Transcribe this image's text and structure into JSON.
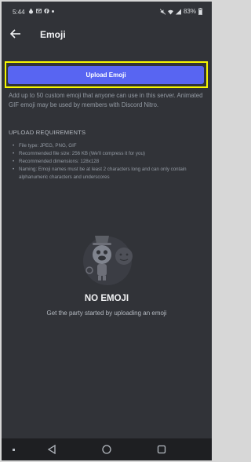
{
  "statusbar": {
    "time": "5:44",
    "battery": "83%"
  },
  "header": {
    "title": "Emoji"
  },
  "upload": {
    "button_label": "Upload Emoji"
  },
  "description": "Add up to 50 custom emoji that anyone can use in this server. Animated GIF emoji may be used by members with Discord Nitro.",
  "requirements": {
    "heading": "UPLOAD REQUIREMENTS",
    "items": [
      "File type: JPEG, PNG, GIF",
      "Recommended file size: 256 KB (We'll compress it for you)",
      "Recommended dimensions: 128x128",
      "Naming: Emoji names must be at least 2 characters long and can only contain alphanumeric characters and underscores"
    ]
  },
  "empty_state": {
    "title": "NO EMOJI",
    "subtitle": "Get the party started by uploading an emoji"
  },
  "colors": {
    "background": "#313338",
    "accent": "#5865f2",
    "highlight": "#f7f700"
  }
}
